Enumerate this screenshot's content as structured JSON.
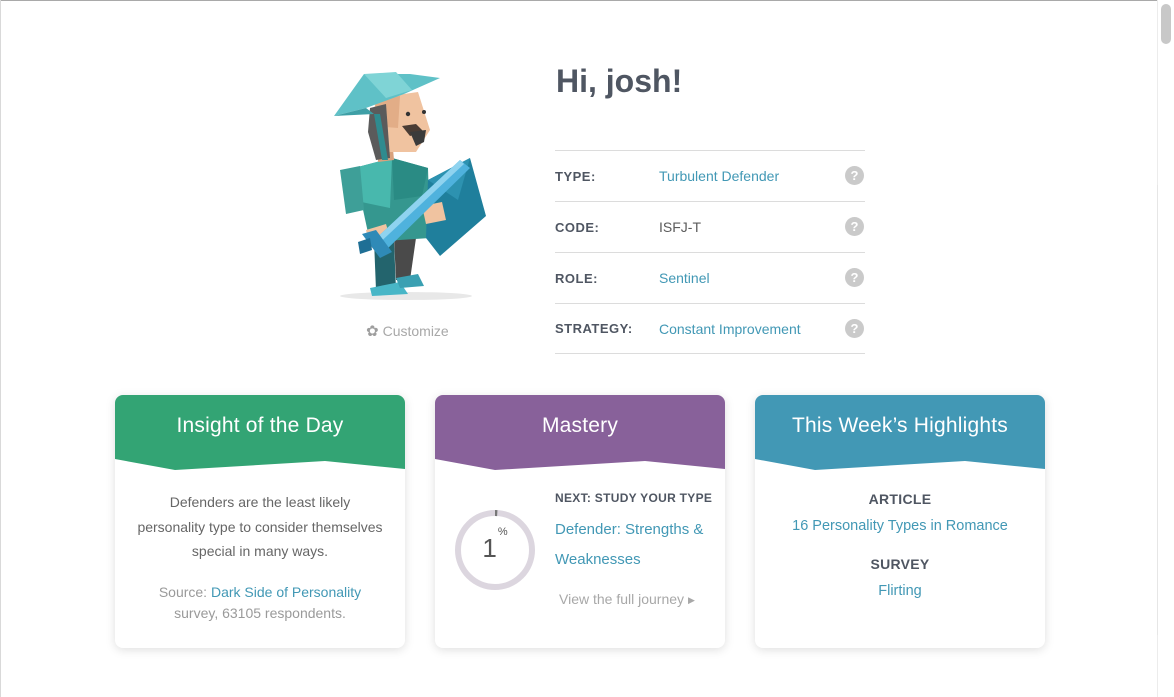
{
  "greeting": "Hi, josh!",
  "avatar": {
    "icon": "defender-avatar-illustration"
  },
  "customize": {
    "label": "Customize",
    "icon": "gear-icon"
  },
  "profile_rows": [
    {
      "label": "TYPE:",
      "value": "Turbulent Defender",
      "link": true,
      "help": "?"
    },
    {
      "label": "CODE:",
      "value": "ISFJ-T",
      "link": false,
      "help": "?"
    },
    {
      "label": "ROLE:",
      "value": "Sentinel",
      "link": true,
      "help": "?"
    },
    {
      "label": "STRATEGY:",
      "value": "Constant Improvement",
      "link": true,
      "help": "?"
    }
  ],
  "colors": {
    "insight": "#33a474",
    "mastery": "#88619a",
    "highlights": "#4298b5",
    "link": "#4298b5"
  },
  "insight": {
    "title": "Insight of the Day",
    "text": "Defenders are the least likely personality type to consider themselves special in many ways.",
    "source_prefix": "Source: ",
    "source_link": "Dark Side of Personality",
    "source_suffix": "survey, 63105 respondents."
  },
  "mastery": {
    "title": "Mastery",
    "progress_value": "1",
    "progress_unit": "%",
    "progress_fraction": 0.01,
    "next_label": "NEXT: STUDY YOUR TYPE",
    "next_link": "Defender: Strengths & Weaknesses",
    "journey_label": "View the full journey",
    "journey_icon": "caret-right-icon"
  },
  "highlights": {
    "title": "This Week’s Highlights",
    "article_label": "ARTICLE",
    "article_link": "16 Personality Types in Romance",
    "survey_label": "SURVEY",
    "survey_link": "Flirting"
  }
}
